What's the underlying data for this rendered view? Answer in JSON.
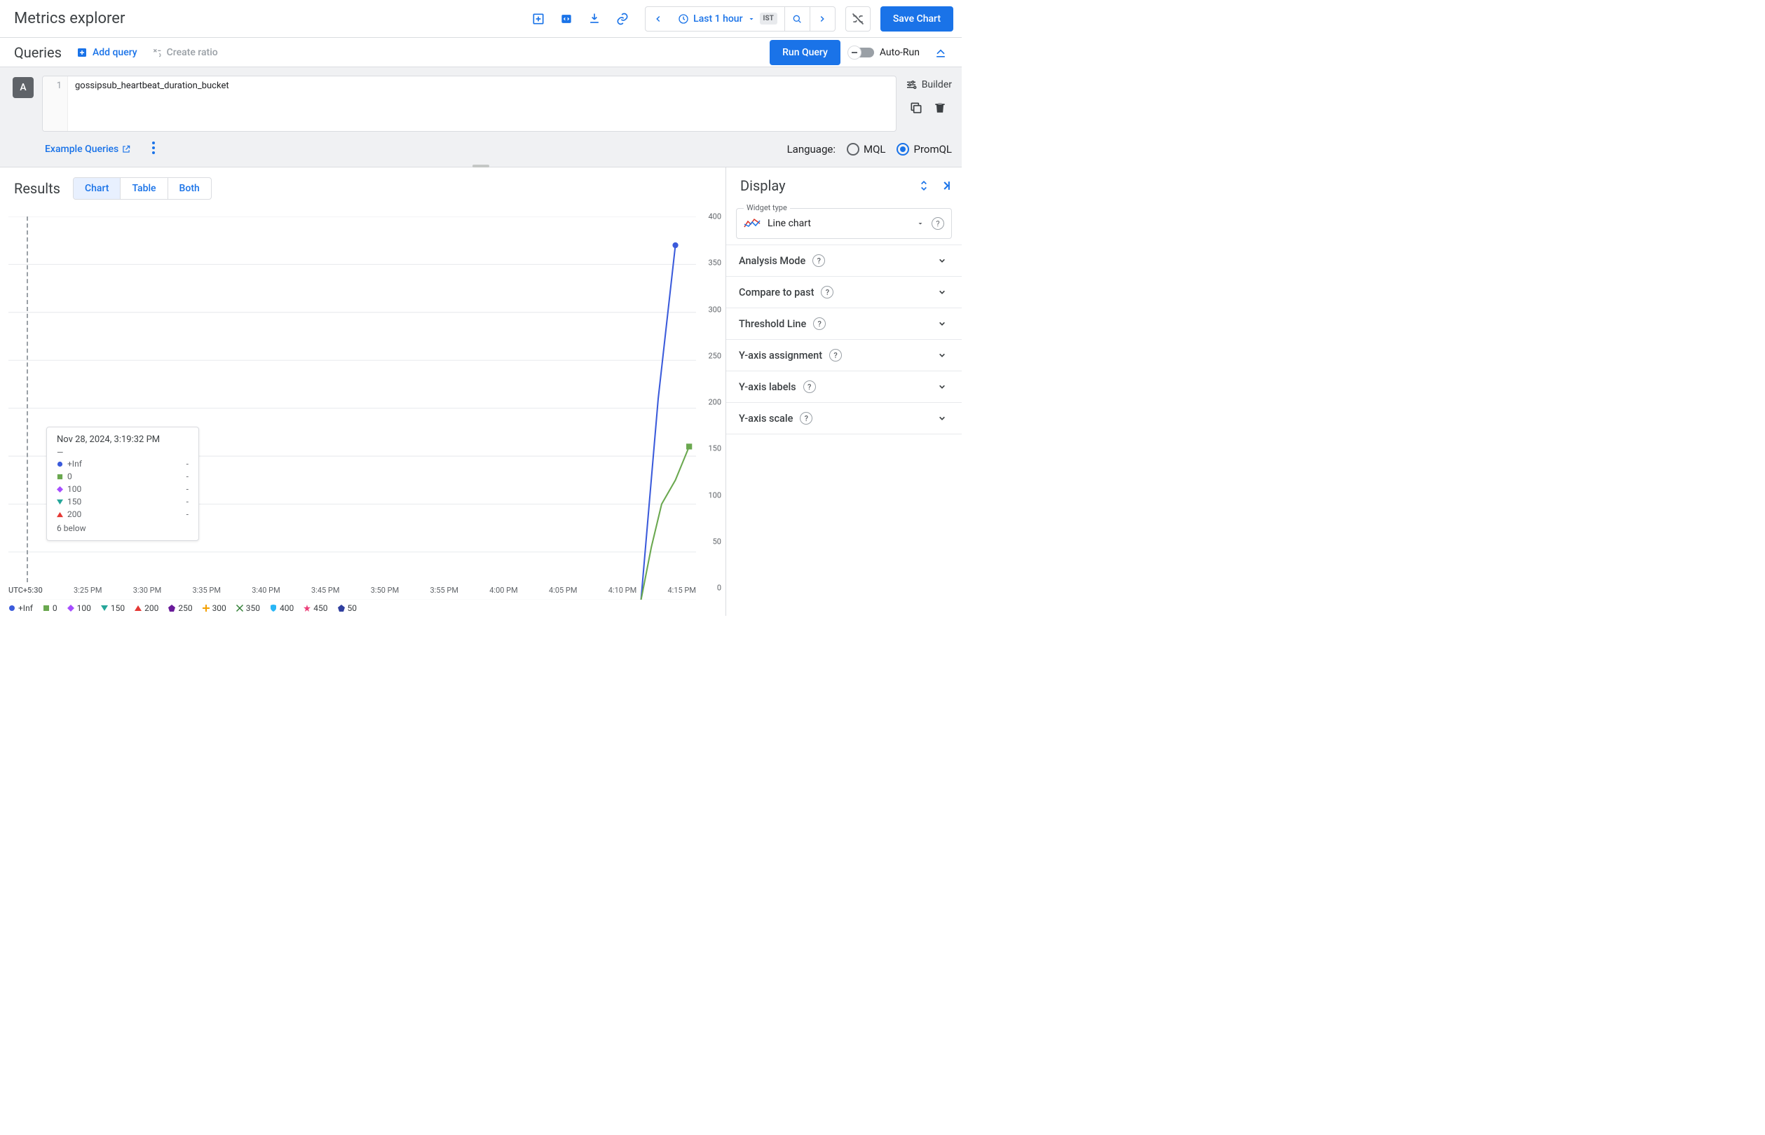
{
  "header": {
    "title": "Metrics explorer",
    "time_range": "Last 1 hour",
    "timezone": "IST",
    "save_button": "Save Chart"
  },
  "queries": {
    "label": "Queries",
    "add_query": "Add query",
    "create_ratio": "Create ratio",
    "run_query": "Run Query",
    "auto_run": "Auto-Run",
    "chip": "A",
    "line_no": "1",
    "code": "gossipsub_heartbeat_duration_bucket",
    "builder": "Builder",
    "example_queries": "Example Queries",
    "language_label": "Language:",
    "lang_mql": "MQL",
    "lang_promql": "PromQL"
  },
  "results": {
    "label": "Results",
    "tabs": {
      "chart": "Chart",
      "table": "Table",
      "both": "Both"
    }
  },
  "chart_data": {
    "type": "line",
    "ylim": [
      0,
      400
    ],
    "yticks": [
      0,
      50,
      100,
      150,
      200,
      250,
      300,
      350,
      400
    ],
    "x_start_label": "UTC+5:30",
    "xticks": [
      "3:25 PM",
      "3:30 PM",
      "3:35 PM",
      "3:40 PM",
      "3:45 PM",
      "3:50 PM",
      "3:55 PM",
      "4:00 PM",
      "4:05 PM",
      "4:10 PM",
      "4:15 PM"
    ],
    "series": [
      {
        "name": "+Inf",
        "color": "#3b5bdb",
        "marker": "circle",
        "points": [
          [
            0.92,
            0
          ],
          [
            0.945,
            210
          ],
          [
            0.97,
            370
          ]
        ]
      },
      {
        "name": "0",
        "color": "#6aa84f",
        "marker": "square",
        "points": [
          [
            0.92,
            0
          ],
          [
            0.935,
            55
          ],
          [
            0.95,
            100
          ],
          [
            0.97,
            125
          ],
          [
            0.99,
            160
          ]
        ]
      }
    ],
    "legend": [
      {
        "name": "+Inf",
        "color": "#3b5bdb",
        "marker": "circle"
      },
      {
        "name": "0",
        "color": "#6aa84f",
        "marker": "square"
      },
      {
        "name": "100",
        "color": "#a64dff",
        "marker": "diamond"
      },
      {
        "name": "150",
        "color": "#26a69a",
        "marker": "tri-down"
      },
      {
        "name": "200",
        "color": "#e53935",
        "marker": "tri-up"
      },
      {
        "name": "250",
        "color": "#6a1b9a",
        "marker": "pentagon"
      },
      {
        "name": "300",
        "color": "#f4a000",
        "marker": "plus"
      },
      {
        "name": "350",
        "color": "#2e7d32",
        "marker": "cross"
      },
      {
        "name": "400",
        "color": "#29b6f6",
        "marker": "shield"
      },
      {
        "name": "450",
        "color": "#ec407a",
        "marker": "star"
      },
      {
        "name": "50",
        "color": "#303f9f",
        "marker": "pentagon"
      }
    ]
  },
  "tooltip": {
    "header": "Nov 28, 2024, 3:19:32 PM",
    "rows": [
      {
        "name": "+Inf",
        "color": "#3b5bdb",
        "marker": "circle",
        "value": "-"
      },
      {
        "name": "0",
        "color": "#6aa84f",
        "marker": "square",
        "value": "-"
      },
      {
        "name": "100",
        "color": "#a64dff",
        "marker": "diamond",
        "value": "-"
      },
      {
        "name": "150",
        "color": "#26a69a",
        "marker": "tri-down",
        "value": "-"
      },
      {
        "name": "200",
        "color": "#e53935",
        "marker": "tri-up",
        "value": "-"
      }
    ],
    "footer": "6 below"
  },
  "display": {
    "label": "Display",
    "widget_type_label": "Widget type",
    "widget_type": "Line chart",
    "sections": [
      "Analysis Mode",
      "Compare to past",
      "Threshold Line",
      "Y-axis assignment",
      "Y-axis labels",
      "Y-axis scale"
    ]
  }
}
